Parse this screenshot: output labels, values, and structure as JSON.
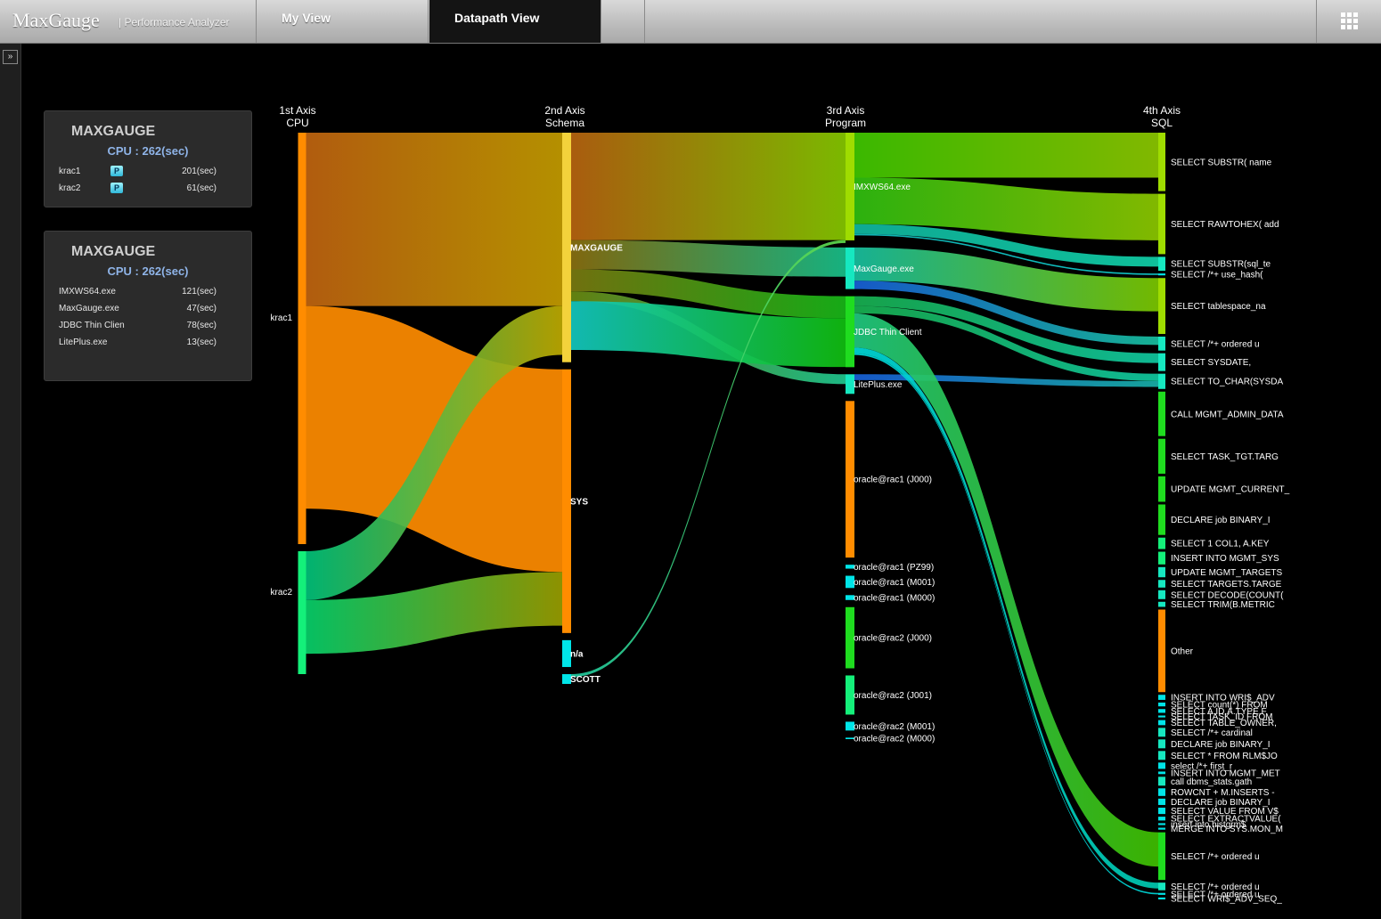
{
  "app": {
    "brand": "MaxGauge",
    "subtitle": "| Performance Analyzer"
  },
  "tabs": [
    {
      "label": "My View",
      "active": false
    },
    {
      "label": "Datapath View",
      "active": true
    }
  ],
  "icons": {
    "menu": "grid-icon",
    "expand": "double-chevron-right-icon",
    "badge": "p-icon"
  },
  "panels": [
    {
      "title": "MAXGAUGE",
      "cpu": "CPU : 262(sec)",
      "rows": [
        {
          "name": "krac1",
          "badge": "P",
          "value": "201(sec)"
        },
        {
          "name": "krac2",
          "badge": "P",
          "value": "61(sec)"
        }
      ]
    },
    {
      "title": "MAXGAUGE",
      "cpu": "CPU : 262(sec)",
      "rows": [
        {
          "name": "IMXWS64.exe",
          "value": "121(sec)"
        },
        {
          "name": "MaxGauge.exe",
          "value": "47(sec)"
        },
        {
          "name": "JDBC Thin Clien",
          "value": "78(sec)"
        },
        {
          "name": "LitePlus.exe",
          "value": "13(sec)"
        }
      ]
    }
  ],
  "axes": [
    {
      "title": "1st Axis",
      "subtitle": "CPU"
    },
    {
      "title": "2nd Axis",
      "subtitle": "Schema"
    },
    {
      "title": "3rd Axis",
      "subtitle": "Program"
    },
    {
      "title": "4th Axis",
      "subtitle": "SQL"
    }
  ],
  "colors": {
    "orange": "#ff8c00",
    "yellow": "#f3d23b",
    "lime": "#9fdc00",
    "green": "#1fdc1f",
    "teal": "#16e8c0",
    "cyan": "#00e5e8",
    "blue": "#1c62d8",
    "spring": "#14f07a"
  },
  "chart_data": {
    "type": "sankey",
    "axis1": [
      {
        "label": "krac1",
        "share": 0.77,
        "color": "orange"
      },
      {
        "label": "krac2",
        "share": 0.23,
        "color": "spring"
      }
    ],
    "axis2": [
      {
        "label": "MAXGAUGE",
        "share": 0.47,
        "color": "yellow"
      },
      {
        "label": "SYS",
        "share": 0.54,
        "color": "orange"
      },
      {
        "label": "n/a",
        "share": 0.055,
        "color": "cyan"
      },
      {
        "label": "SCOTT",
        "share": 0.02,
        "color": "cyan"
      }
    ],
    "axis3": [
      {
        "label": "IMXWS64.exe",
        "share": 0.22,
        "color": "lime"
      },
      {
        "label": "MaxGauge.exe",
        "share": 0.085,
        "color": "teal"
      },
      {
        "label": "JDBC Thin Client",
        "share": 0.145,
        "color": "green"
      },
      {
        "label": "LitePlus.exe",
        "share": 0.04,
        "color": "teal"
      },
      {
        "label": "oracle@rac1 (J000)",
        "share": 0.32,
        "color": "orange"
      },
      {
        "label": "oracle@rac1 (PZ99)",
        "share": 0.008,
        "color": "cyan"
      },
      {
        "label": "oracle@rac1 (M001)",
        "share": 0.025,
        "color": "cyan"
      },
      {
        "label": "oracle@rac1 (M000)",
        "share": 0.01,
        "color": "cyan"
      },
      {
        "label": "oracle@rac2 (J000)",
        "share": 0.125,
        "color": "green"
      },
      {
        "label": "oracle@rac2 (J001)",
        "share": 0.08,
        "color": "spring"
      },
      {
        "label": "oracle@rac2 (M001)",
        "share": 0.018,
        "color": "cyan"
      },
      {
        "label": "oracle@rac2 (M000)",
        "share": 0.003,
        "color": "cyan"
      }
    ],
    "axis4": [
      {
        "label": "SELECT SUBSTR( name",
        "share": 0.092,
        "color": "lime"
      },
      {
        "label": "SELECT RAWTOHEX( add",
        "share": 0.095,
        "color": "lime"
      },
      {
        "label": "SELECT SUBSTR(sql_te",
        "share": 0.022,
        "color": "teal"
      },
      {
        "label": "SELECT /*+ use_hash(",
        "share": 0.003,
        "color": "cyan"
      },
      {
        "label": "SELECT tablespace_na",
        "share": 0.088,
        "color": "lime"
      },
      {
        "label": "SELECT /*+ ordered u",
        "share": 0.022,
        "color": "teal"
      },
      {
        "label": "SELECT SYSDATE,",
        "share": 0.028,
        "color": "teal"
      },
      {
        "label": "SELECT TO_CHAR(SYSDA",
        "share": 0.024,
        "color": "teal"
      },
      {
        "label": "CALL MGMT_ADMIN_DATA",
        "share": 0.07,
        "color": "green"
      },
      {
        "label": "SELECT TASK_TGT.TARG",
        "share": 0.055,
        "color": "green"
      },
      {
        "label": "UPDATE MGMT_CURRENT_",
        "share": 0.04,
        "color": "green"
      },
      {
        "label": "DECLARE job BINARY_I",
        "share": 0.048,
        "color": "green"
      },
      {
        "label": "SELECT 1 COL1, A.KEY",
        "share": 0.018,
        "color": "spring"
      },
      {
        "label": "INSERT INTO MGMT_SYS",
        "share": 0.02,
        "color": "spring"
      },
      {
        "label": "UPDATE MGMT_TARGETS",
        "share": 0.016,
        "color": "teal"
      },
      {
        "label": "SELECT TARGETS.TARGE",
        "share": 0.012,
        "color": "teal"
      },
      {
        "label": "SELECT DECODE(COUNT(",
        "share": 0.014,
        "color": "teal"
      },
      {
        "label": "SELECT TRIM(B.METRIC",
        "share": 0.008,
        "color": "teal"
      },
      {
        "label": "Other",
        "share": 0.13,
        "color": "orange"
      },
      {
        "label": "INSERT INTO WRI$_ADV",
        "share": 0.008,
        "color": "cyan"
      },
      {
        "label": "SELECT count(*) FROM",
        "share": 0.006,
        "color": "cyan"
      },
      {
        "label": "SELECT A.ID,A.TYPE,F",
        "share": 0.006,
        "color": "cyan"
      },
      {
        "label": "SELECT TASK_ID FROM",
        "share": 0.003,
        "color": "cyan"
      },
      {
        "label": "SELECT TABLE_OWNER,",
        "share": 0.008,
        "color": "cyan"
      },
      {
        "label": "SELECT /*+  cardinal",
        "share": 0.014,
        "color": "teal"
      },
      {
        "label": "DECLARE job BINARY_I",
        "share": 0.014,
        "color": "teal"
      },
      {
        "label": "SELECT * FROM RLM$JO",
        "share": 0.014,
        "color": "teal"
      },
      {
        "label": "select   /*+ first_r",
        "share": 0.01,
        "color": "cyan"
      },
      {
        "label": "INSERT INTO MGMT_MET",
        "share": 0.004,
        "color": "cyan"
      },
      {
        "label": "call dbms_stats.gath",
        "share": 0.014,
        "color": "teal"
      },
      {
        "label": "ROWCNT + M.INSERTS -",
        "share": 0.012,
        "color": "cyan"
      },
      {
        "label": "DECLARE job BINARY_I",
        "share": 0.01,
        "color": "cyan"
      },
      {
        "label": "SELECT VALUE FROM V$",
        "share": 0.01,
        "color": "cyan"
      },
      {
        "label": "SELECT EXTRACTVALUE(",
        "share": 0.006,
        "color": "cyan"
      },
      {
        "label": "insert into histgrm$",
        "share": 0.003,
        "color": "cyan"
      },
      {
        "label": "MERGE INTO SYS.MON_M",
        "share": 0.003,
        "color": "cyan"
      },
      {
        "label": "SELECT /*+ ordered u",
        "share": 0.075,
        "color": "green"
      },
      {
        "label": "SELECT /*+ ordered u",
        "share": 0.012,
        "color": "teal"
      },
      {
        "label": "SELECT /*+ ordered u",
        "share": 0.003,
        "color": "cyan"
      },
      {
        "label": "SELECT WRI$_ADV_SEQ_",
        "share": 0.003,
        "color": "cyan"
      }
    ],
    "flows": [
      {
        "from": [
          0,
          0
        ],
        "to": [
          1,
          0
        ],
        "share": 0.355,
        "c1": "#c06410",
        "c2": "#c49c00"
      },
      {
        "from": [
          0,
          0
        ],
        "to": [
          1,
          1
        ],
        "share": 0.415,
        "c1": "#ff8c00",
        "c2": "#ff8c00"
      },
      {
        "from": [
          0,
          1
        ],
        "to": [
          1,
          0
        ],
        "share": 0.1,
        "c1": "#00c27a",
        "c2": "#bfaa00"
      },
      {
        "from": [
          0,
          1
        ],
        "to": [
          1,
          1
        ],
        "share": 0.11,
        "c1": "#06d06a",
        "c2": "#9a9e00"
      },
      {
        "from": [
          1,
          0
        ],
        "to": [
          2,
          0
        ],
        "share": 0.22,
        "c1": "#b86410",
        "c2": "#86c800"
      },
      {
        "from": [
          1,
          0
        ],
        "to": [
          2,
          1
        ],
        "share": 0.06,
        "c1": "#8a7010",
        "c2": "#18c08a"
      },
      {
        "from": [
          1,
          0
        ],
        "to": [
          2,
          2
        ],
        "share": 0.045,
        "c1": "#7a7a10",
        "c2": "#18b818"
      },
      {
        "from": [
          1,
          0
        ],
        "to": [
          2,
          3
        ],
        "share": 0.02,
        "c1": "#6a8a10",
        "c2": "#20c890"
      },
      {
        "from": [
          1,
          0
        ],
        "to": [
          2,
          2
        ],
        "share": 0.1,
        "c1": "#13c8c0",
        "c2": "#10c010"
      },
      {
        "from": [
          1,
          3
        ],
        "to": [
          2,
          0
        ],
        "share": 0.006,
        "c1": "#20c8a0",
        "c2": "#5fd84a"
      }
    ],
    "flows_right": [
      {
        "from": 0,
        "to": 0,
        "share": 0.092,
        "c1": "#40c800",
        "c2": "#8cc800"
      },
      {
        "from": 0,
        "to": 1,
        "share": 0.095,
        "c1": "#30c010",
        "c2": "#8cc800"
      },
      {
        "from": 0,
        "to": 2,
        "share": 0.02,
        "c1": "#10b8a0",
        "c2": "#10d0a8"
      },
      {
        "from": 0,
        "to": 3,
        "share": 0.003,
        "c1": "#10c0c0",
        "c2": "#10d0d0"
      },
      {
        "from": 1,
        "to": 4,
        "share": 0.068,
        "c1": "#18c0a0",
        "c2": "#7cc800"
      },
      {
        "from": 1,
        "to": 5,
        "share": 0.017,
        "c1": "#1860d8",
        "c2": "#18c0a0"
      },
      {
        "from": 2,
        "to": 6,
        "share": 0.02,
        "c1": "#18b050",
        "c2": "#10c8a0"
      },
      {
        "from": 2,
        "to": 7,
        "share": 0.015,
        "c1": "#18b050",
        "c2": "#10c8a0"
      },
      {
        "from": 3,
        "to": 7,
        "share": 0.012,
        "c1": "#1860d8",
        "c2": "#18b0a8"
      },
      {
        "from": 2,
        "to": 36,
        "share": 0.07,
        "c1": "#20c880",
        "c2": "#40c000"
      },
      {
        "from": 2,
        "to": 37,
        "share": 0.012,
        "c1": "#00d8d8",
        "c2": "#00c8b0"
      },
      {
        "from": 2,
        "to": 38,
        "share": 0.003,
        "c1": "#00d8d8",
        "c2": "#00d8d8"
      }
    ]
  }
}
